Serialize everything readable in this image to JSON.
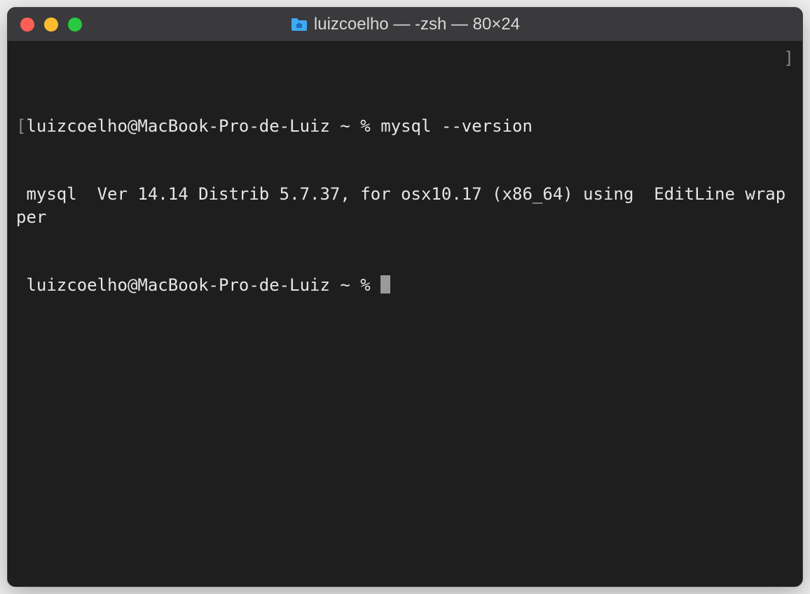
{
  "window": {
    "title": "luizcoelho — -zsh — 80×24"
  },
  "terminal": {
    "line1_open_bracket": "[",
    "line1_prompt": "luizcoelho@MacBook-Pro-de-Luiz ~ % ",
    "line1_command": "mysql --version",
    "line1_close_bracket": "]",
    "line2_output": " mysql  Ver 14.14 Distrib 5.7.37, for osx10.17 (x86_64) using  EditLine wrapper",
    "line3_prompt": " luizcoelho@MacBook-Pro-de-Luiz ~ % "
  }
}
